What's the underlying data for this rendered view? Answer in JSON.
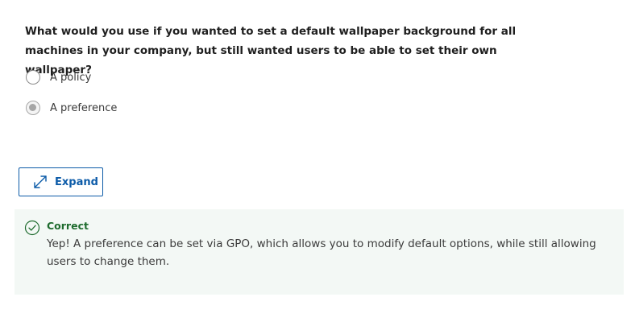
{
  "question": {
    "text": "What would you use if you wanted to set a default wallpaper background for all machines in your company, but still wanted users to be able to set their own wallpaper?"
  },
  "options": [
    {
      "label": "A policy",
      "selected": false
    },
    {
      "label": "A preference",
      "selected": true
    }
  ],
  "expand_button": {
    "label": "Expand",
    "icon": "expand-arrows-icon"
  },
  "feedback": {
    "status": "Correct",
    "icon": "check-circle-icon",
    "message": "Yep! A preference can be set via GPO, which allows you to modify default options, while still allowing users to change them."
  },
  "colors": {
    "accent": "#0c5ba8",
    "success": "#1e6b2e",
    "feedback_background": "#f3f8f5"
  }
}
